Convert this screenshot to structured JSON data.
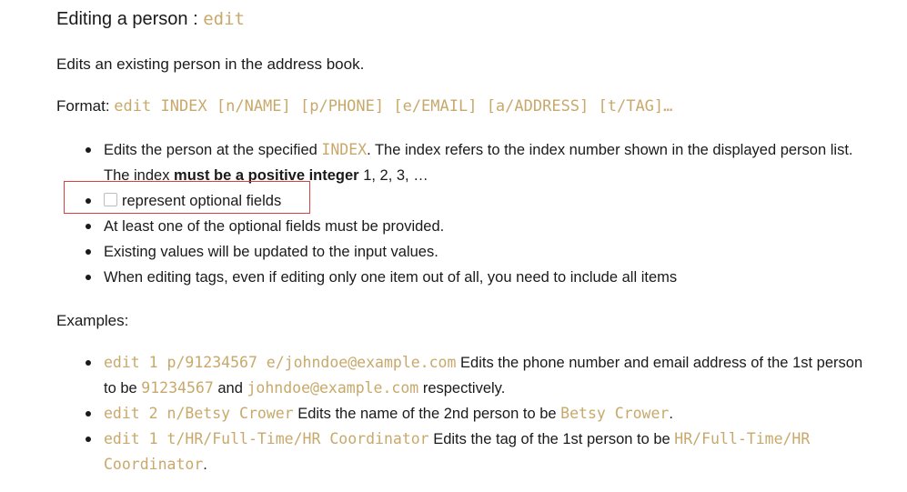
{
  "heading": {
    "text": "Editing a person : ",
    "command": "edit"
  },
  "description": "Edits an existing person in the address book.",
  "format": {
    "label": "Format: ",
    "syntax": "edit INDEX [n/NAME] [p/PHONE] [e/EMAIL] [a/ADDRESS] [t/TAG]…"
  },
  "notes": {
    "item1": {
      "p1": "Edits the person at the specified ",
      "code": "INDEX",
      "p2": ". The index refers to the index number shown in the displayed person list. The index ",
      "bold": "must be a positive integer",
      "p3": " 1, 2, 3, …"
    },
    "item2": "represent optional fields",
    "item3": "At least one of the optional fields must be provided.",
    "item4": "Existing values will be updated to the input values.",
    "item5": "When editing tags, even if editing only one item out of all, you need to include all items"
  },
  "examples_label": "Examples:",
  "examples": {
    "ex1": {
      "command": "edit 1 p/91234567 e/johndoe@example.com",
      "t1": " Edits the phone number and email address of the 1st person to be ",
      "v1": "91234567",
      "t2": " and ",
      "v2": "johndoe@example.com",
      "t3": " respectively."
    },
    "ex2": {
      "command": "edit 2 n/Betsy Crower",
      "t1": " Edits the name of the 2nd person to be ",
      "v1": "Betsy Crower",
      "t2": "."
    },
    "ex3": {
      "command": "edit 1 t/HR/Full-Time/HR Coordinator",
      "t1": " Edits the tag of the 1st person to be ",
      "v1": "HR/Full-Time/HR Coordinator",
      "t2": "."
    }
  },
  "colors": {
    "code": "#c8a96b",
    "highlight_border": "#d94040",
    "text": "#1a1a1a"
  }
}
